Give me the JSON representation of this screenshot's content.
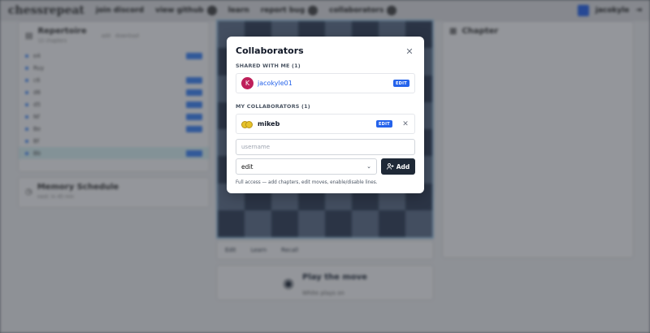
{
  "background": {
    "logo": "chessrepeat",
    "nav": [
      "join discord",
      "view github",
      "learn",
      "report bug",
      "collaborators"
    ],
    "user": "jacokyle",
    "repertoire_title": "Repertoire",
    "repertoire_sub": "12 chapters",
    "repertoire_actions": [
      "add",
      "download"
    ],
    "repertoire_items": [
      "e4",
      "Ruy",
      "c6",
      "d6",
      "d5",
      "Nf",
      "Be",
      "Bf",
      "Bb"
    ],
    "schedule_title": "Memory Schedule",
    "schedule_sub": "next: in 45 min",
    "chapter_title": "Chapter",
    "board_buttons": [
      "Edit",
      "Learn",
      "Recall"
    ],
    "play_title": "Play the move",
    "play_sub": "White plays on"
  },
  "modal": {
    "title": "Collaborators",
    "shared_header": "SHARED WITH ME (1)",
    "shared": {
      "avatar_letter": "K",
      "name": "jacokyle01",
      "badge": "EDIT"
    },
    "mine_header": "MY COLLABORATORS (1)",
    "mine": {
      "name": "mikeb",
      "badge": "EDIT"
    },
    "username_placeholder": "username",
    "permission_value": "edit",
    "add_label": "Add",
    "help_text": "Full access — add chapters, edit moves, enable/disable lines."
  },
  "colors": {
    "accent": "#2563eb",
    "avatar_k": "#be1f5a",
    "button_dark": "#1f2937"
  }
}
